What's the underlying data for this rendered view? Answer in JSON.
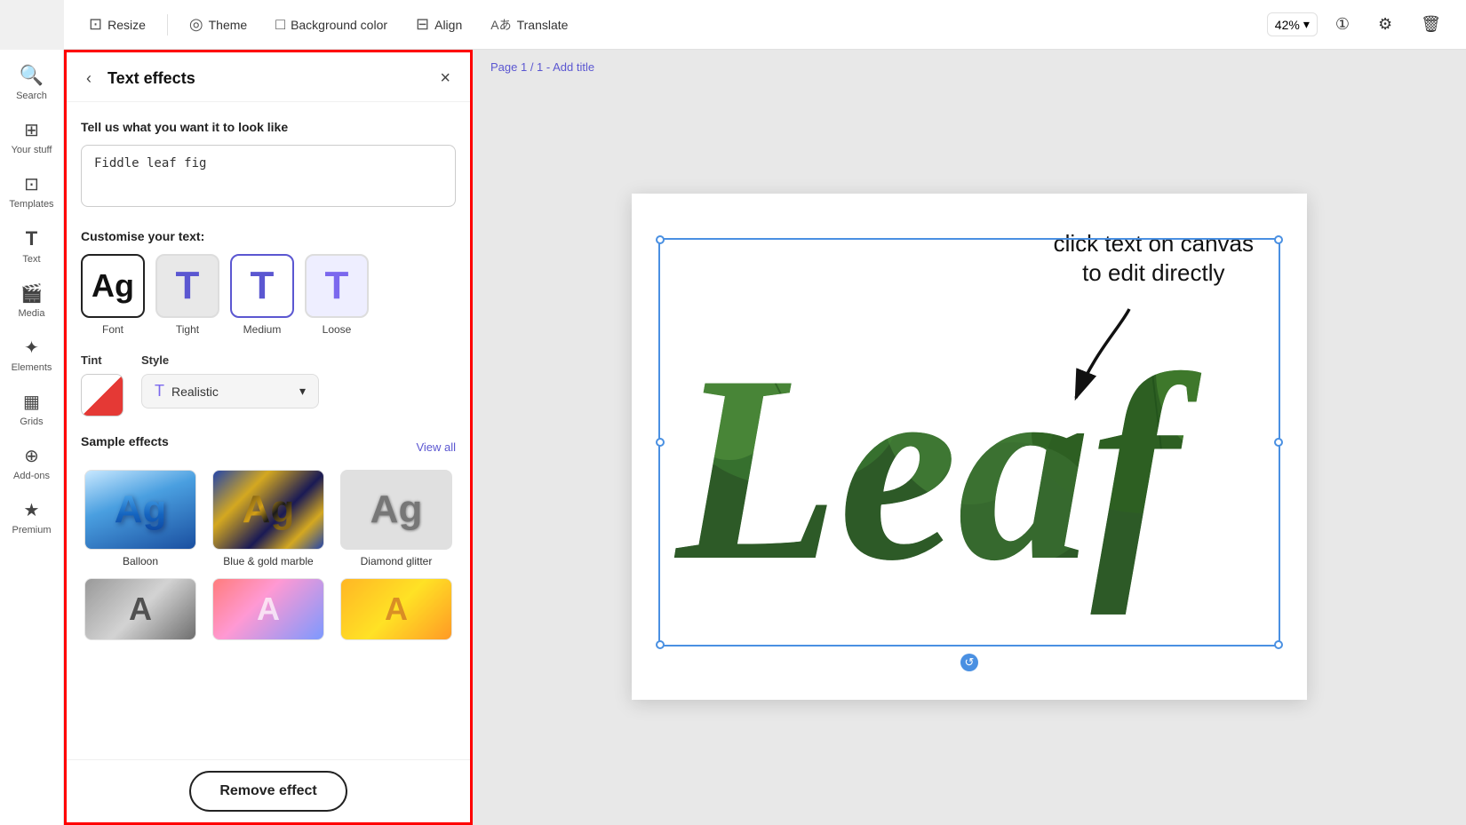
{
  "toolbar": {
    "resize_label": "Resize",
    "theme_label": "Theme",
    "bg_color_label": "Background color",
    "align_label": "Align",
    "translate_label": "Translate",
    "zoom_value": "42%",
    "resize_icon": "⊡",
    "theme_icon": "◎",
    "bg_icon": "□",
    "align_icon": "⊟",
    "translate_icon": "Aあ"
  },
  "sidebar": {
    "items": [
      {
        "id": "search",
        "label": "Search",
        "icon": "🔍"
      },
      {
        "id": "your-stuff",
        "label": "Your stuff",
        "icon": "⊞"
      },
      {
        "id": "templates",
        "label": "Templates",
        "icon": "⊡"
      },
      {
        "id": "text",
        "label": "Text",
        "icon": "T"
      },
      {
        "id": "media",
        "label": "Media",
        "icon": "🎬"
      },
      {
        "id": "elements",
        "label": "Elements",
        "icon": "✦"
      },
      {
        "id": "grids",
        "label": "Grids",
        "icon": "⊞"
      },
      {
        "id": "add-ons",
        "label": "Add-ons",
        "icon": "⊕"
      },
      {
        "id": "premium",
        "label": "Premium",
        "icon": "★"
      }
    ]
  },
  "panel": {
    "title": "Text effects",
    "back_label": "‹",
    "close_label": "×",
    "prompt_label": "Tell us what you want it to look like",
    "prompt_placeholder": "Fiddle leaf fig",
    "customise_label": "Customise your text:",
    "style_options": [
      {
        "id": "font",
        "label": "Font",
        "char": "Ag"
      },
      {
        "id": "tight",
        "label": "Tight",
        "char": "T"
      },
      {
        "id": "medium",
        "label": "Medium",
        "char": "T"
      },
      {
        "id": "loose",
        "label": "Loose",
        "char": "T"
      }
    ],
    "tint_label": "Tint",
    "style_label": "Style",
    "style_dropdown_value": "Realistic",
    "sample_effects_label": "Sample effects",
    "view_all_label": "View all",
    "effects": [
      {
        "id": "balloon",
        "label": "Balloon"
      },
      {
        "id": "marble",
        "label": "Blue & gold marble"
      },
      {
        "id": "glitter",
        "label": "Diamond glitter"
      }
    ],
    "remove_effect_label": "Remove effect"
  },
  "canvas": {
    "page_info": "Page 1 / 1",
    "add_title": "Add title",
    "tooltip_text": "click text on canvas\nto edit directly",
    "canvas_text": "Leaf"
  }
}
